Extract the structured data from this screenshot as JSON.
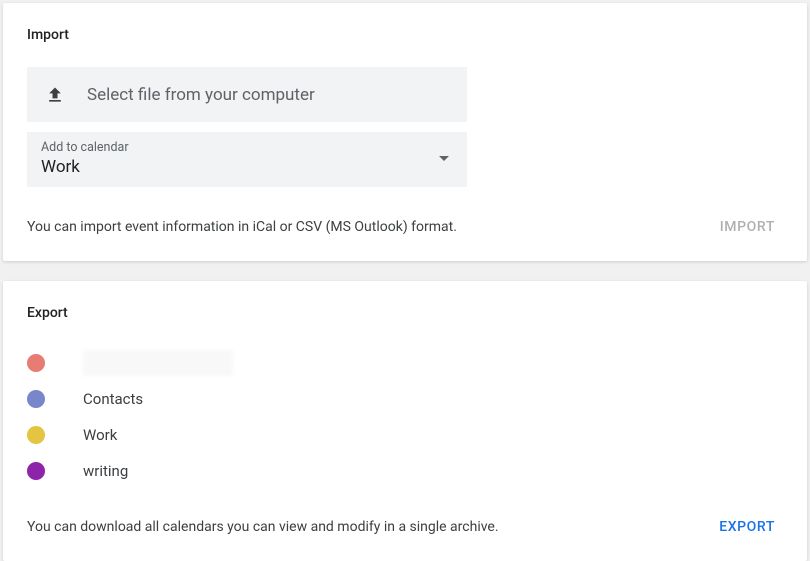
{
  "import": {
    "title": "Import",
    "file_picker_label": "Select file from your computer",
    "dropdown_label": "Add to calendar",
    "dropdown_value": "Work",
    "footer_text": "You can import event information in iCal or CSV (MS Outlook) format.",
    "button_label": "IMPORT"
  },
  "export": {
    "title": "Export",
    "calendars": [
      {
        "color": "#e67c73",
        "name": ""
      },
      {
        "color": "#7986cb",
        "name": "Contacts"
      },
      {
        "color": "#e4c441",
        "name": "Work"
      },
      {
        "color": "#8e24aa",
        "name": "writing"
      }
    ],
    "footer_text": "You can download all calendars you can view and modify in a single archive.",
    "button_label": "EXPORT"
  }
}
